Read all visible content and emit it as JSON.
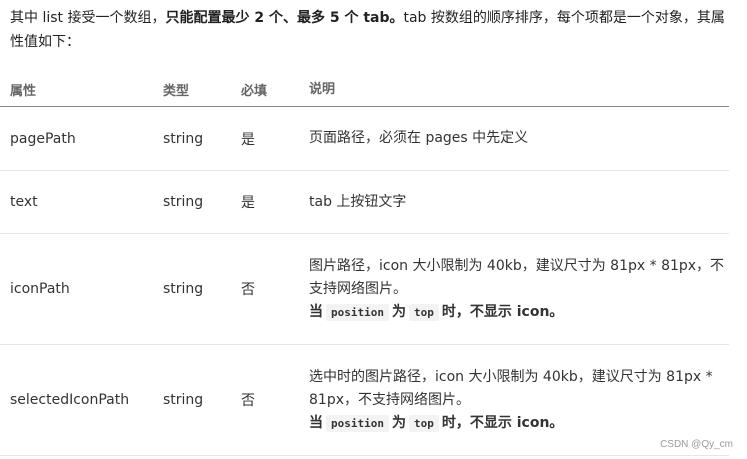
{
  "intro": {
    "part1": "其中 list 接受一个数组，",
    "bold": "只能配置最少 2 个、最多 5 个 tab。",
    "part2": "tab 按数组的顺序排序，每个项都是一个对象，其属性值如下："
  },
  "table": {
    "headers": {
      "name": "属性",
      "type": "类型",
      "required": "必填",
      "desc": "说明"
    },
    "rows": [
      {
        "name": "pagePath",
        "type": "string",
        "required": "是",
        "desc": "页面路径，必须在 pages 中先定义"
      },
      {
        "name": "text",
        "type": "string",
        "required": "是",
        "desc": "tab 上按钮文字"
      },
      {
        "name": "iconPath",
        "type": "string",
        "required": "否",
        "desc": "图片路径，icon 大小限制为 40kb，建议尺寸为 81px * 81px，不支持网络图片。",
        "note": {
          "when": "当",
          "code1": "position",
          "is": "为",
          "code2": "top",
          "rest": "时，不显示 icon。"
        }
      },
      {
        "name": "selectedIconPath",
        "type": "string",
        "required": "否",
        "desc": "选中时的图片路径，icon 大小限制为 40kb，建议尺寸为 81px * 81px，不支持网络图片。",
        "note": {
          "when": "当",
          "code1": "position",
          "is": "为",
          "code2": "top",
          "rest": "时，不显示 icon。"
        }
      }
    ]
  },
  "watermark": "CSDN @Qy_cm"
}
